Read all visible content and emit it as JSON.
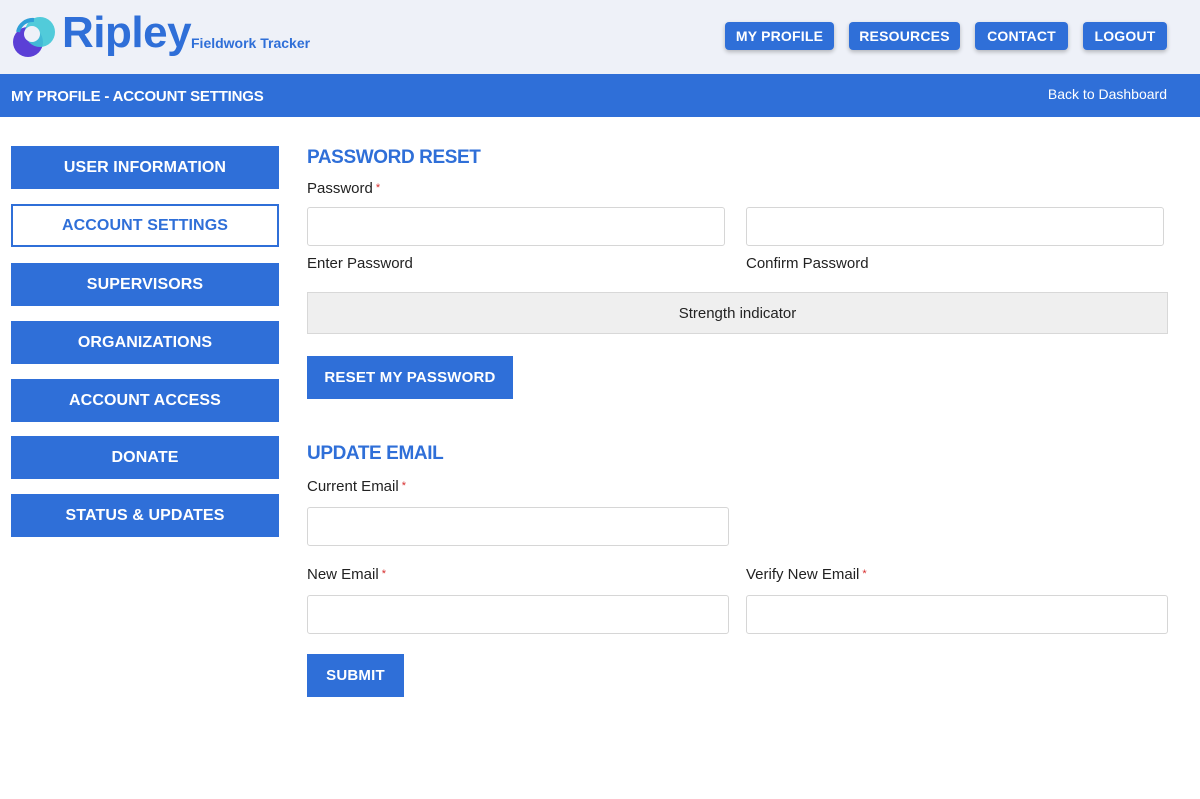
{
  "header": {
    "brand": "Ripley",
    "tagline": "Fieldwork Tracker",
    "logo_icon": "ripley-logo-icon",
    "nav": [
      "MY PROFILE",
      "RESOURCES",
      "CONTACT",
      "LOGOUT"
    ]
  },
  "titlebar": {
    "title": "MY PROFILE - ACCOUNT SETTINGS",
    "back_link": "Back to Dashboard"
  },
  "sidebar": {
    "items": [
      {
        "label": "USER INFORMATION",
        "active": false
      },
      {
        "label": "ACCOUNT SETTINGS",
        "active": true
      },
      {
        "label": "SUPERVISORS",
        "active": false
      },
      {
        "label": "ORGANIZATIONS",
        "active": false
      },
      {
        "label": "ACCOUNT ACCESS",
        "active": false
      },
      {
        "label": "DONATE",
        "active": false
      },
      {
        "label": "STATUS & UPDATES",
        "active": false
      }
    ]
  },
  "password_reset": {
    "title": "PASSWORD RESET",
    "password_label": "Password",
    "required_marker": "*",
    "enter_password_value": "",
    "confirm_password_value": "",
    "enter_password_helper": "Enter Password",
    "confirm_password_helper": "Confirm Password",
    "strength_indicator": "Strength indicator",
    "reset_button": "RESET MY PASSWORD"
  },
  "update_email": {
    "title": "UPDATE EMAIL",
    "current_email_label": "Current Email",
    "current_email_value": "",
    "new_email_label": "New Email",
    "new_email_value": "",
    "verify_email_label": "Verify New Email",
    "verify_email_value": "",
    "required_marker": "*",
    "submit_button": "SUBMIT"
  },
  "colors": {
    "accent": "#2f6fd8",
    "header_bg": "#eef1f8",
    "required": "#d62d2d"
  }
}
